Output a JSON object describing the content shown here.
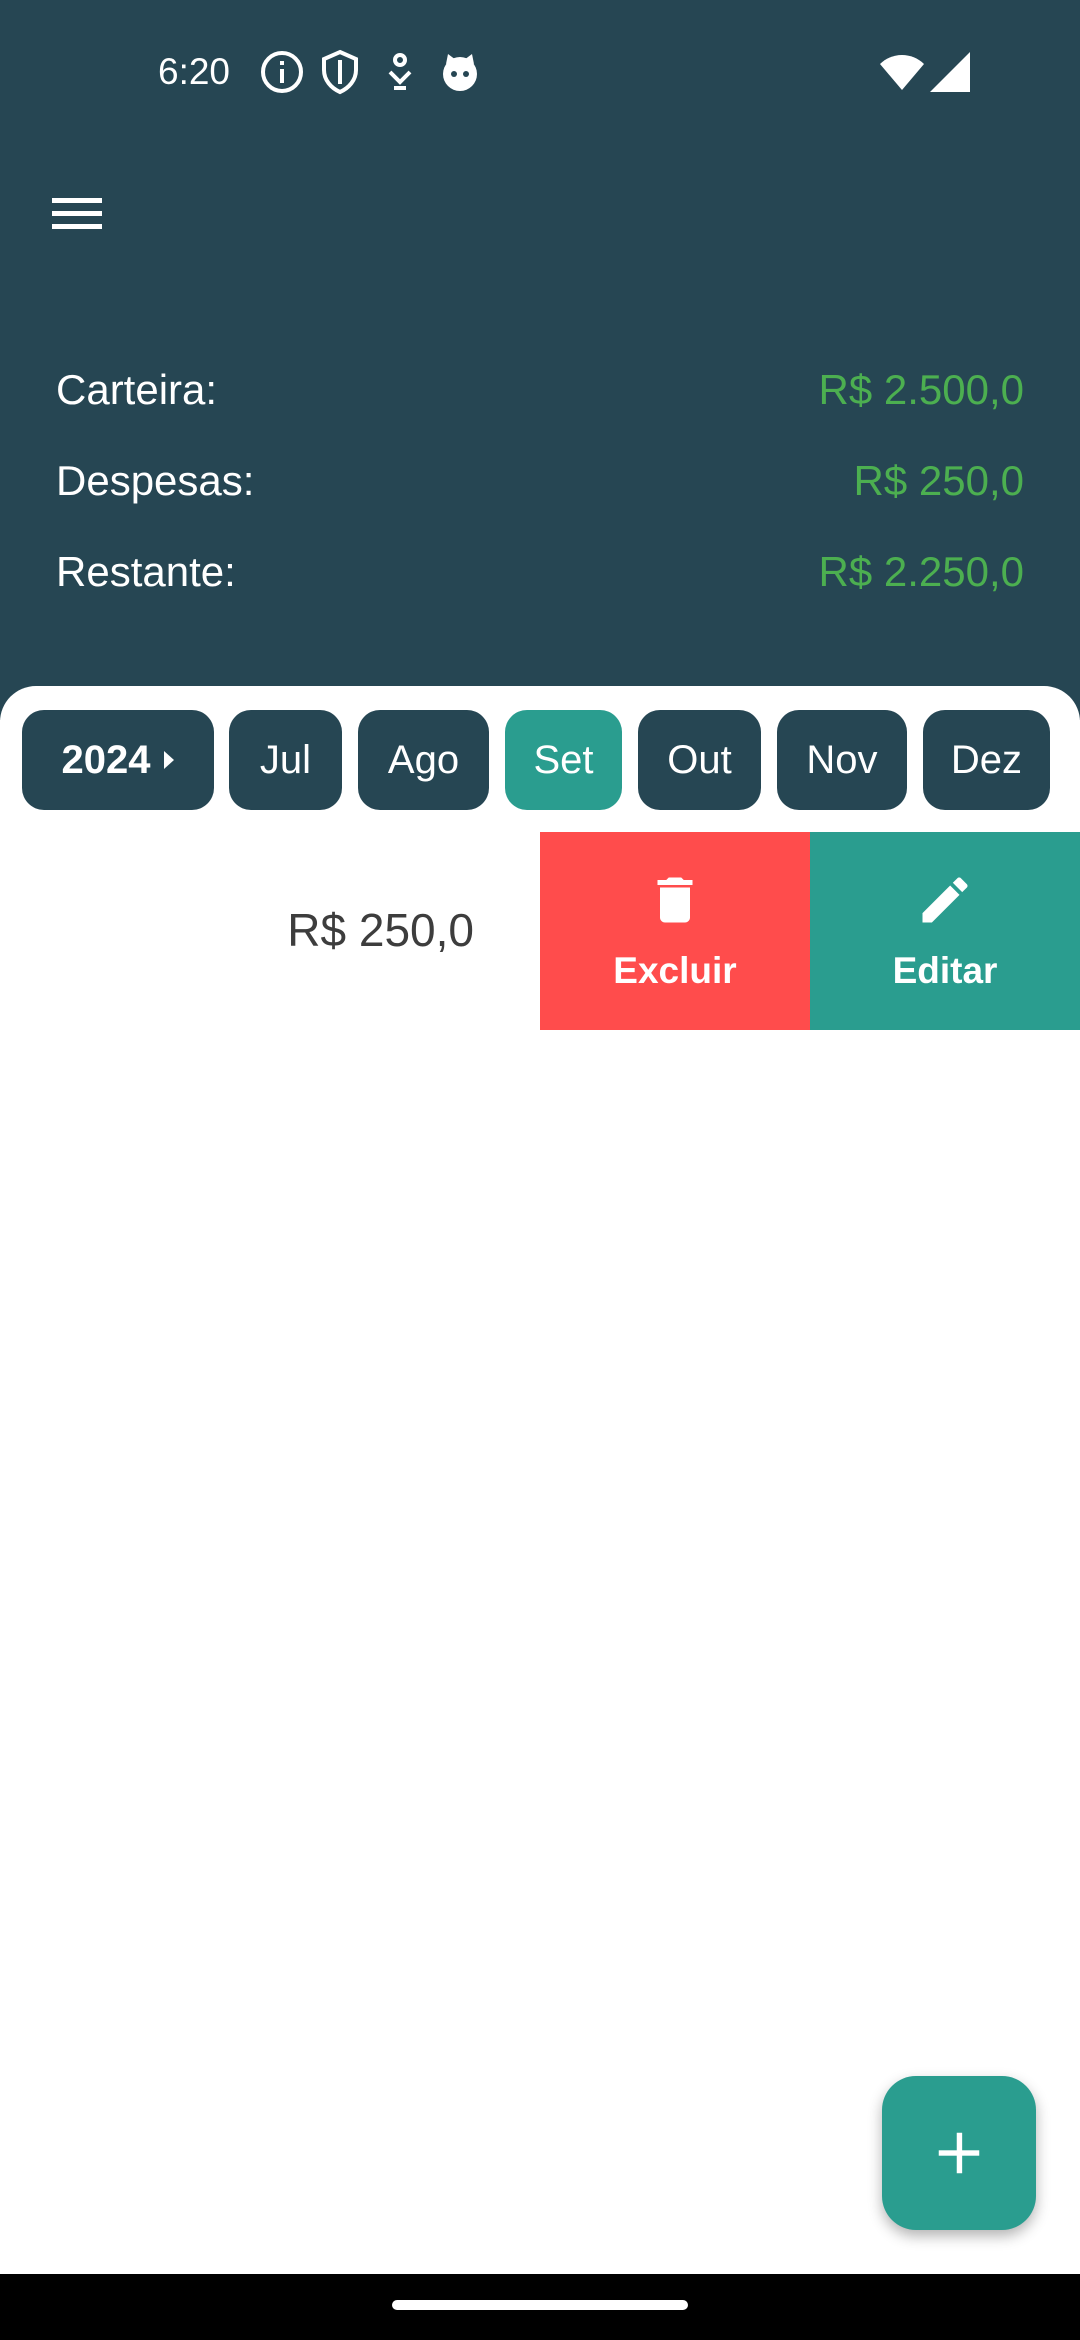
{
  "status_bar": {
    "time": "6:20",
    "icons": [
      "info-icon",
      "shield-icon",
      "download-icon",
      "cat-icon",
      "wifi-icon",
      "signal-icon"
    ]
  },
  "header": {
    "menu_icon": "menu-icon",
    "summary": {
      "wallet_label": "Carteira:",
      "wallet_value": "R$ 2.500,0",
      "expenses_label": "Despesas:",
      "expenses_value": "R$ 250,0",
      "remaining_label": "Restante:",
      "remaining_value": "R$ 2.250,0"
    }
  },
  "months": {
    "year": "2024",
    "items": [
      "Jul",
      "Ago",
      "Set",
      "Out",
      "Nov",
      "Dez"
    ],
    "selected": "Set"
  },
  "expenses": {
    "items": [
      {
        "amount": "R$ 250,0",
        "delete_label": "Excluir",
        "edit_label": "Editar"
      }
    ]
  },
  "fab": {
    "icon": "plus-icon"
  },
  "colors": {
    "header_bg": "#264653",
    "accent": "#2a9d8f",
    "value_green": "#4caf50",
    "delete_red": "#ff4c4c"
  }
}
